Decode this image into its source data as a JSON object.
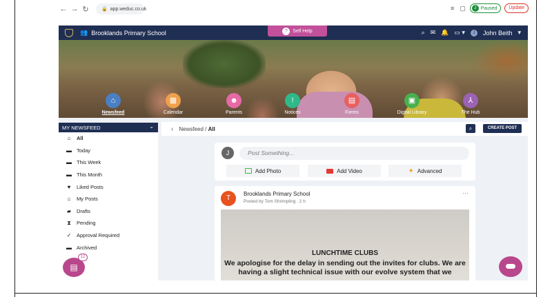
{
  "browser": {
    "url": "app.weduc.co.uk",
    "profile_status": "Paused",
    "profile_initial": "J",
    "update_label": "Update"
  },
  "header": {
    "school_name": "Brooklands Primary School",
    "self_help_label": "Self Help",
    "user_name": "John Beith",
    "user_initial": "J"
  },
  "hero_nav": [
    {
      "label": "Newsfeed",
      "icon": "home-icon",
      "color": "#4a7fc4",
      "active": true
    },
    {
      "label": "Calendar",
      "icon": "calendar-icon",
      "color": "#f0a04b"
    },
    {
      "label": "Parents",
      "icon": "people-icon",
      "color": "#e66aa6"
    },
    {
      "label": "Notices",
      "icon": "notice-icon",
      "color": "#2fb88a"
    },
    {
      "label": "Forms",
      "icon": "form-icon",
      "color": "#e95f5f"
    },
    {
      "label": "Digital Library",
      "icon": "library-icon",
      "color": "#49b04f"
    },
    {
      "label": "The Hub",
      "icon": "hub-icon",
      "color": "#9b63b5"
    }
  ],
  "sidebar": {
    "title": "MY NEWSFEED",
    "items": [
      {
        "label": "All",
        "icon": "home-icon",
        "active": true
      },
      {
        "label": "Today",
        "icon": "calendar-icon"
      },
      {
        "label": "This Week",
        "icon": "calendar-icon"
      },
      {
        "label": "This Month",
        "icon": "calendar-icon"
      },
      {
        "label": "Liked Posts",
        "icon": "heart-icon"
      },
      {
        "label": "My Posts",
        "icon": "home-icon"
      },
      {
        "label": "Drafts",
        "icon": "folder-icon"
      },
      {
        "label": "Pending",
        "icon": "hourglass-icon"
      },
      {
        "label": "Approval Required",
        "icon": "check-icon"
      },
      {
        "label": "Archived",
        "icon": "archive-icon"
      }
    ]
  },
  "main": {
    "breadcrumb_root": "Newsfeed",
    "breadcrumb_sep": "/",
    "breadcrumb_current": "All",
    "create_post_label": "CREATE POST"
  },
  "composer": {
    "avatar_initial": "J",
    "placeholder": "Post Something...",
    "add_photo": "Add Photo",
    "add_video": "Add Video",
    "advanced": "Advanced"
  },
  "post": {
    "avatar_initial": "T",
    "author": "Brooklands Primary School",
    "meta": "Posted by Tom Shrimpling . 2 h",
    "image_title": "LUNCHTIME CLUBS",
    "image_body": "We apologise for the delay in sending out the invites for clubs. We are having a slight technical issue with our evolve system that we"
  },
  "fab": {
    "badge_count": "12"
  }
}
